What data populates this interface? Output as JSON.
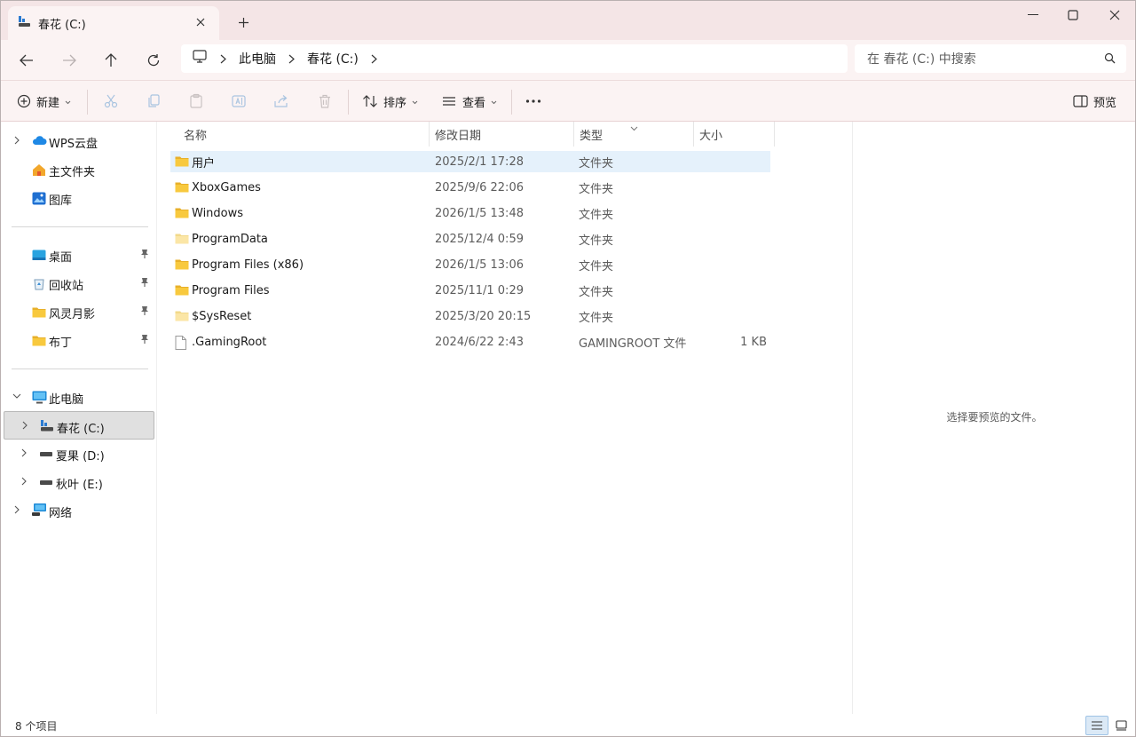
{
  "window": {
    "tab_title": "春花 (C:)"
  },
  "address": {
    "crumbs": [
      "此电脑",
      "春花 (C:)"
    ],
    "search_placeholder": "在 春花 (C:) 中搜索"
  },
  "toolbar": {
    "new_label": "新建",
    "sort_label": "排序",
    "view_label": "查看",
    "preview_label": "预览"
  },
  "sidebar": {
    "top": [
      {
        "label": "WPS云盘",
        "icon": "cloud-icon"
      },
      {
        "label": "主文件夹",
        "icon": "home-icon"
      },
      {
        "label": "图库",
        "icon": "gallery-icon"
      }
    ],
    "quick": [
      {
        "label": "桌面",
        "icon": "desktop-icon"
      },
      {
        "label": "回收站",
        "icon": "recycle-bin-icon"
      },
      {
        "label": "风灵月影",
        "icon": "folder-icon"
      },
      {
        "label": "布丁",
        "icon": "folder-icon"
      }
    ],
    "pc": {
      "label": "此电脑",
      "icon": "computer-icon"
    },
    "drives": [
      {
        "label": "春花 (C:)",
        "icon": "system-drive-icon"
      },
      {
        "label": "夏果 (D:)",
        "icon": "drive-icon"
      },
      {
        "label": "秋叶 (E:)",
        "icon": "drive-icon"
      }
    ],
    "network": {
      "label": "网络",
      "icon": "network-icon"
    }
  },
  "columns": [
    "名称",
    "修改日期",
    "类型",
    "大小"
  ],
  "files": [
    {
      "name": "用户",
      "date": "2025/2/1 17:28",
      "type": "文件夹",
      "size": "",
      "icon": "folder-icon"
    },
    {
      "name": "XboxGames",
      "date": "2025/9/6 22:06",
      "type": "文件夹",
      "size": "",
      "icon": "folder-icon"
    },
    {
      "name": "Windows",
      "date": "2026/1/5 13:48",
      "type": "文件夹",
      "size": "",
      "icon": "folder-icon"
    },
    {
      "name": "ProgramData",
      "date": "2025/12/4 0:59",
      "type": "文件夹",
      "size": "",
      "icon": "hidden-folder-icon"
    },
    {
      "name": "Program Files (x86)",
      "date": "2026/1/5 13:06",
      "type": "文件夹",
      "size": "",
      "icon": "folder-icon"
    },
    {
      "name": "Program Files",
      "date": "2025/11/1 0:29",
      "type": "文件夹",
      "size": "",
      "icon": "folder-icon"
    },
    {
      "name": "$SysReset",
      "date": "2025/3/20 20:15",
      "type": "文件夹",
      "size": "",
      "icon": "hidden-folder-icon"
    },
    {
      "name": ".GamingRoot",
      "date": "2024/6/22 2:43",
      "type": "GAMINGROOT 文件",
      "size": "1 KB",
      "icon": "file-icon"
    }
  ],
  "preview_pane": {
    "message": "选择要预览的文件。"
  },
  "status": {
    "count": "8 个项目"
  },
  "colors": {
    "accent": "#0067c0",
    "folder": "#f8c93e",
    "selected_row": "#e5f1fb",
    "chrome": "#fbf3f3"
  }
}
